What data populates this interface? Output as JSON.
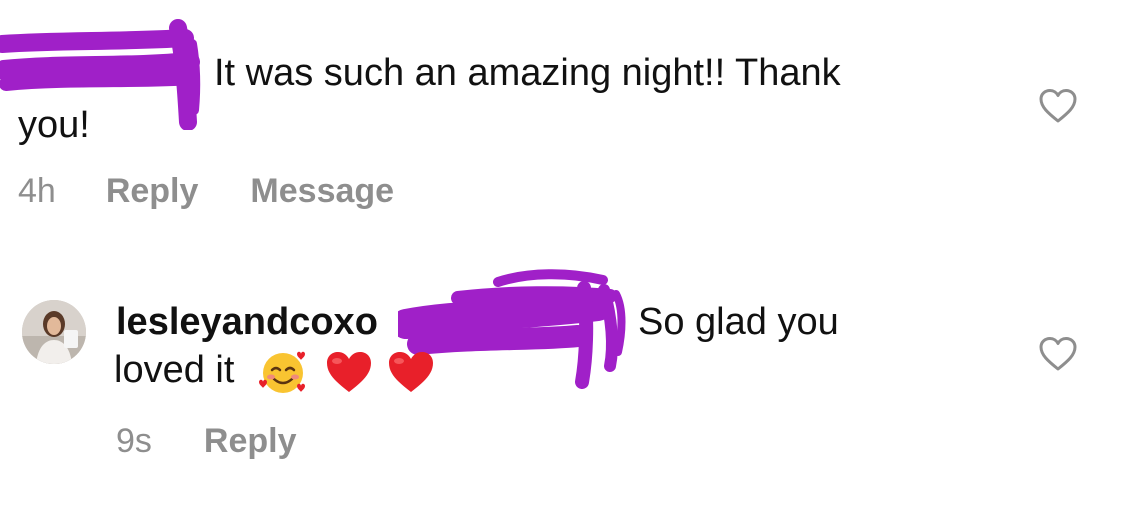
{
  "comments": [
    {
      "text_line1": "It was such an amazing night!! Thank",
      "text_line2": "you!",
      "time": "4h",
      "reply_label": "Reply",
      "message_label": "Message",
      "like_icon": "heart-outline-icon"
    },
    {
      "username": "lesleyandcoxo",
      "text_part": "So glad you",
      "text_line2": "loved it",
      "emojis": [
        "smiling-face-with-hearts",
        "red-heart",
        "red-heart"
      ],
      "time": "9s",
      "reply_label": "Reply",
      "like_icon": "heart-outline-icon"
    }
  ],
  "colors": {
    "redaction": "#a020c8",
    "meta_text": "#8e8e8e",
    "heart_red": "#e8202a"
  }
}
